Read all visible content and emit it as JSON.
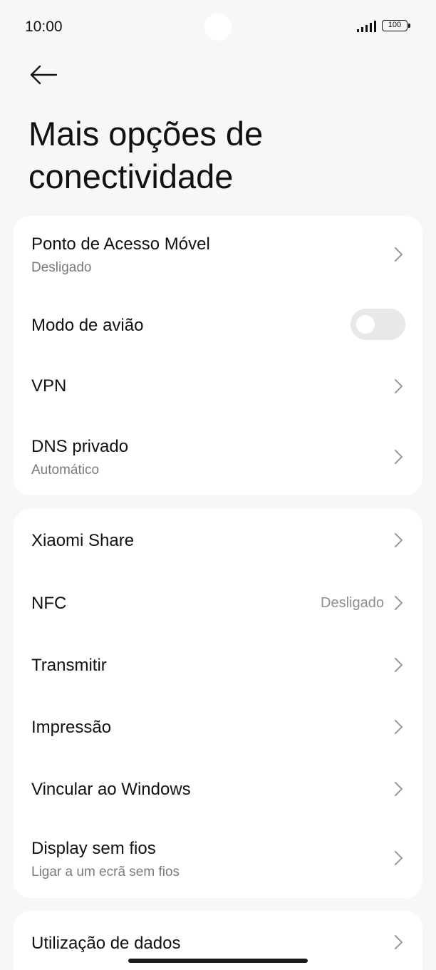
{
  "status": {
    "time": "10:00",
    "battery": "100"
  },
  "header": {
    "title": "Mais opções de conectividade"
  },
  "card1": {
    "hotspot": {
      "title": "Ponto de Acesso Móvel",
      "subtitle": "Desligado"
    },
    "airplane": {
      "title": "Modo de avião",
      "enabled": false
    },
    "vpn": {
      "title": "VPN"
    },
    "dns": {
      "title": "DNS privado",
      "subtitle": "Automático"
    }
  },
  "card2": {
    "xiaomi_share": {
      "title": "Xiaomi Share"
    },
    "nfc": {
      "title": "NFC",
      "value": "Desligado"
    },
    "cast": {
      "title": "Transmitir"
    },
    "print": {
      "title": "Impressão"
    },
    "windows": {
      "title": "Vincular ao Windows"
    },
    "wireless_display": {
      "title": "Display sem fios",
      "subtitle": "Ligar a um ecrã sem fios"
    }
  },
  "card3": {
    "data_usage": {
      "title": "Utilização de dados"
    }
  },
  "icons": {
    "back": "arrow-left-icon",
    "chevron": "chevron-right-icon",
    "signal": "signal-icon",
    "battery": "battery-icon"
  }
}
